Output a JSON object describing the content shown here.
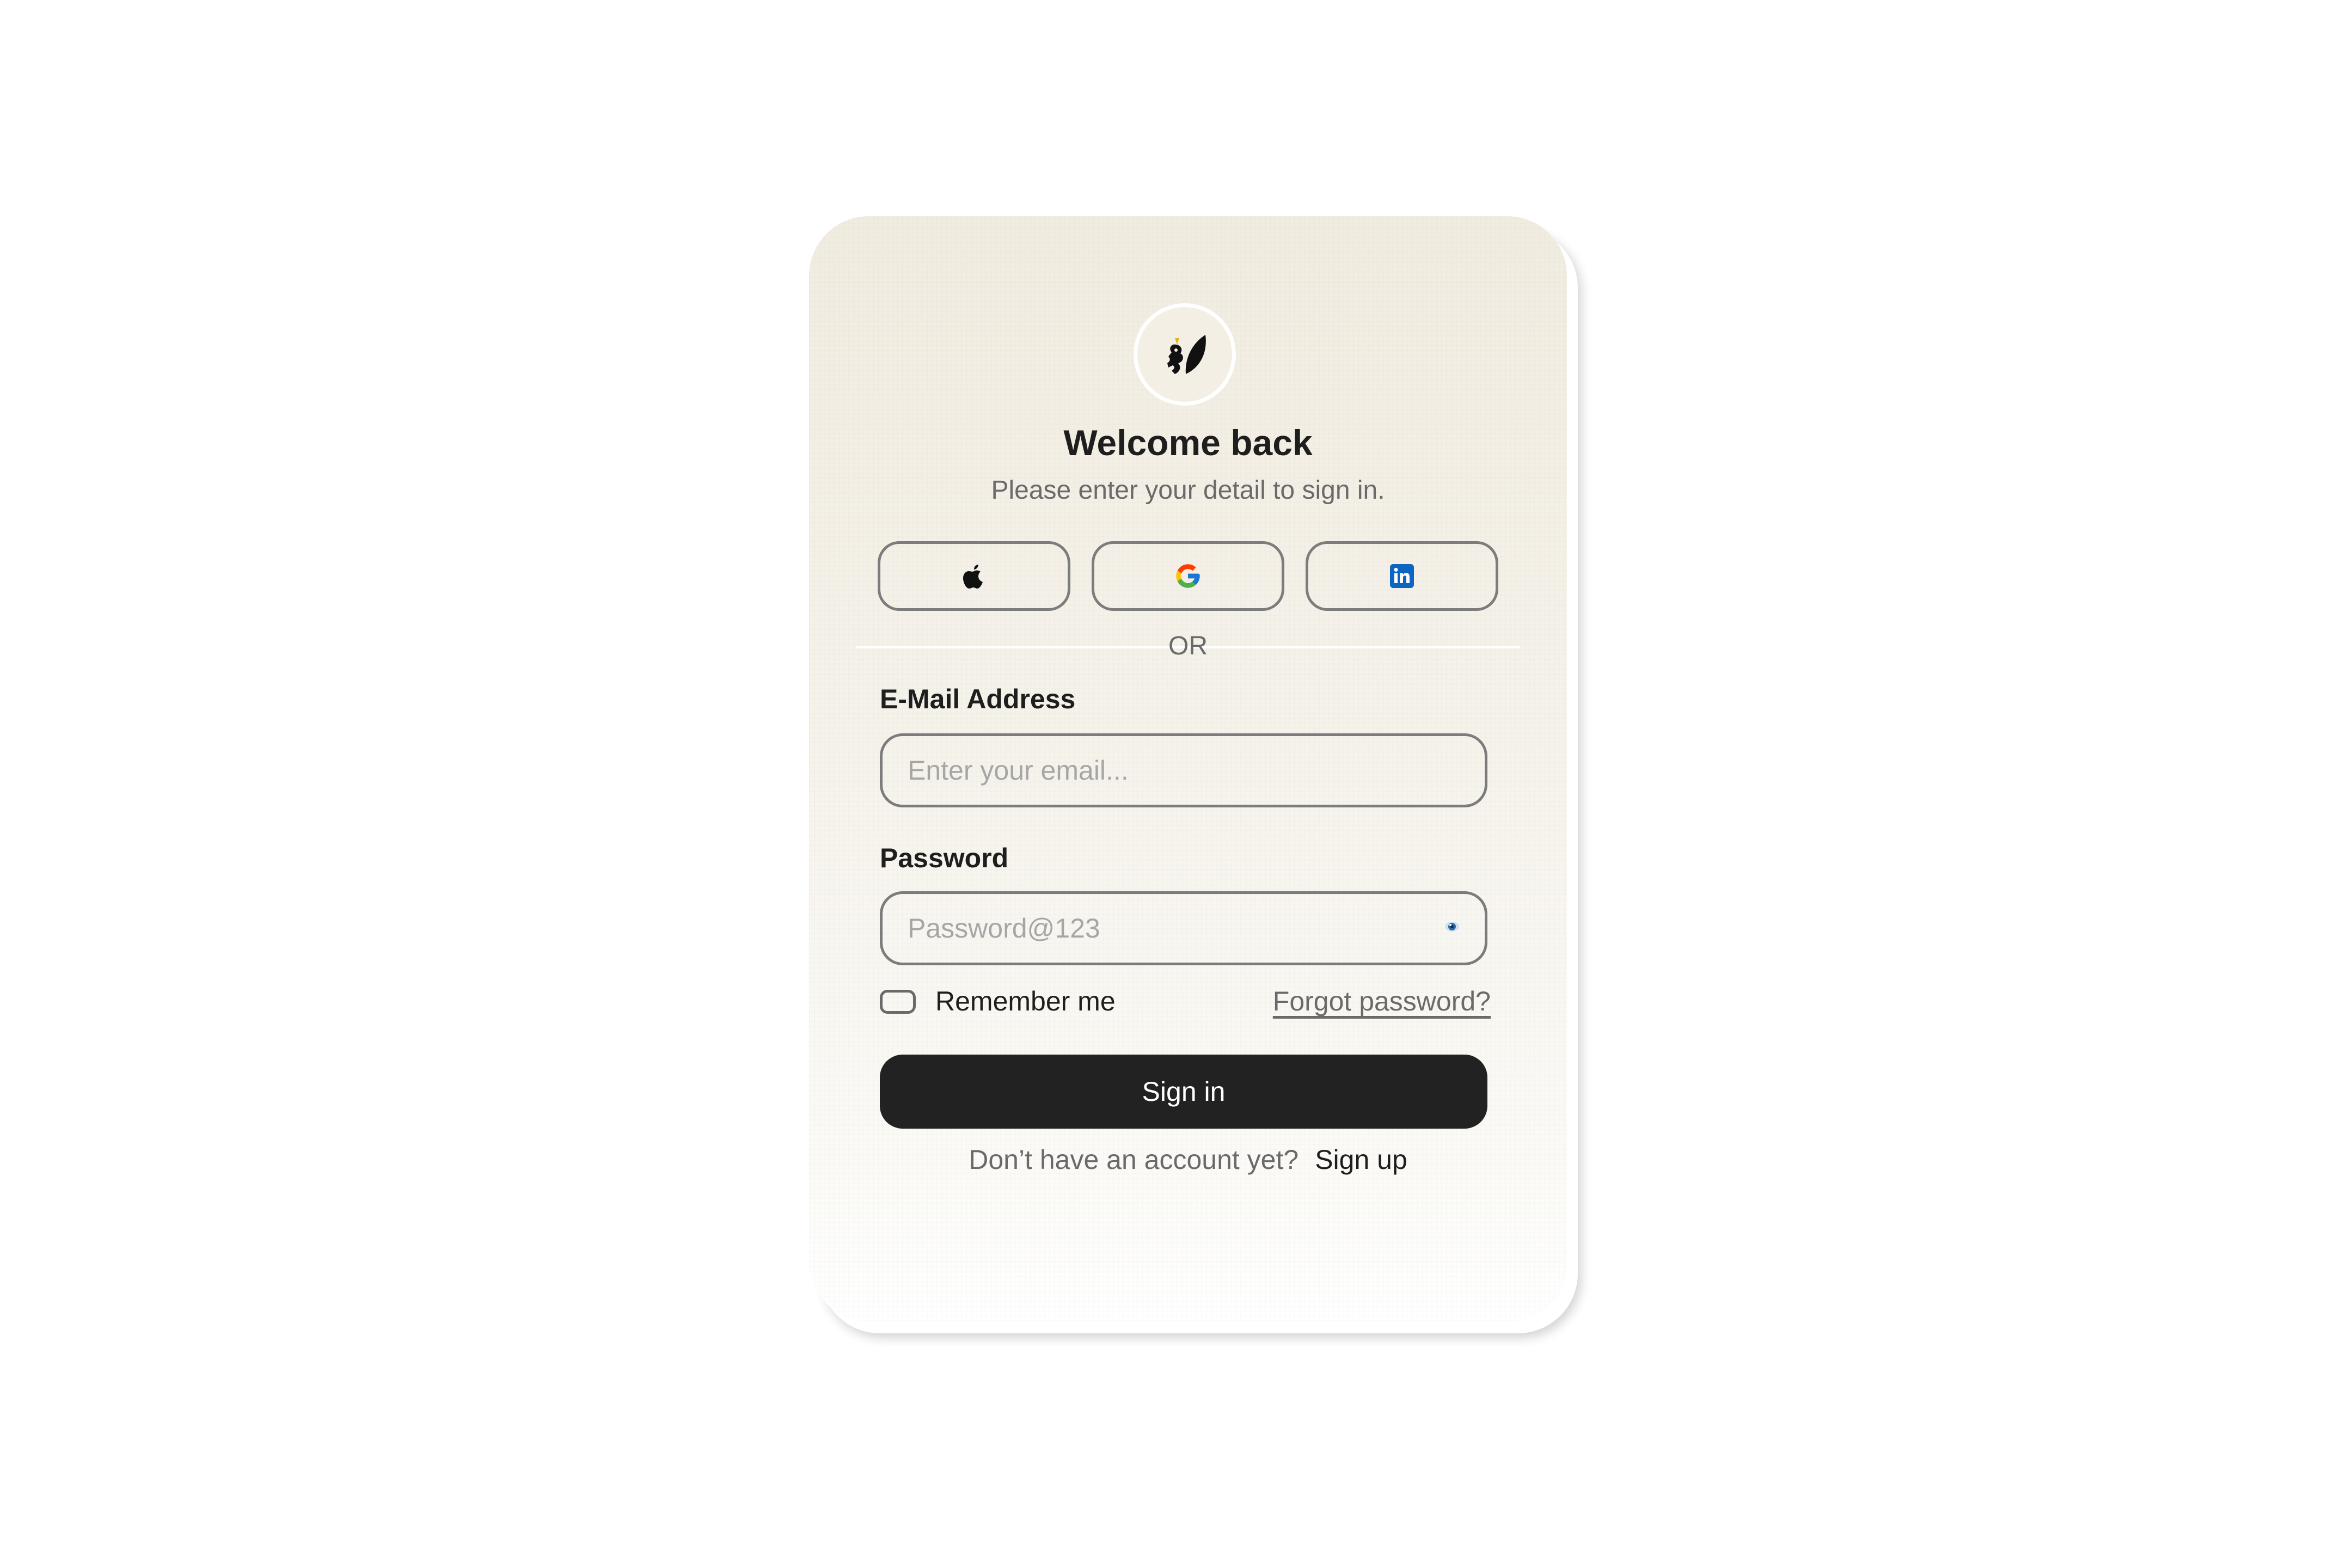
{
  "header": {
    "title": "Welcome back",
    "subtitle": "Please enter your detail to sign in."
  },
  "social": {
    "apple_icon": "apple-icon",
    "google_icon": "google-icon",
    "linkedin_icon": "linkedin-icon"
  },
  "divider_text": "OR",
  "email": {
    "label": "E-Mail Address",
    "placeholder": "Enter your email...",
    "value": ""
  },
  "password": {
    "label": "Password",
    "placeholder": "Password@123",
    "value": ""
  },
  "remember": {
    "label": "Remember me",
    "checked": false
  },
  "forgot_label": "Forgot password?",
  "signin_label": "Sign in",
  "footer": {
    "prompt": "Don’t have an account yet?",
    "signup_label": "Sign up"
  },
  "colors": {
    "primary_button": "#222222",
    "border": "#7c7c7c",
    "text": "#1e1e1e",
    "muted": "#6a6a6a",
    "linkedin": "#0a66c2"
  }
}
